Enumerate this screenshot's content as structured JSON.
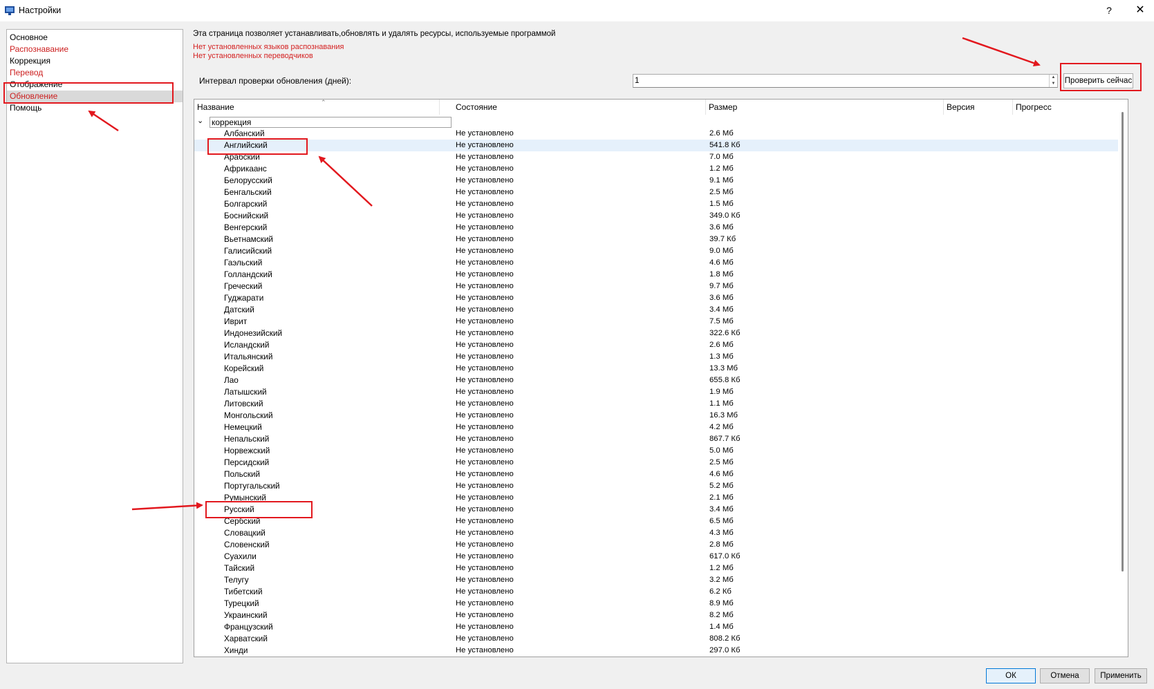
{
  "window": {
    "title": "Настройки",
    "help_label": "?",
    "close_label": "✕"
  },
  "sidebar": {
    "items": [
      {
        "label": "Основное",
        "color": "#000000"
      },
      {
        "label": "Распознавание",
        "color": "#cc1f1f"
      },
      {
        "label": "Коррекция",
        "color": "#000000"
      },
      {
        "label": "Перевод",
        "color": "#cc1f1f"
      },
      {
        "label": "Отображение",
        "color": "#000000"
      },
      {
        "label": "Обновление",
        "color": "#cc1f1f",
        "selected": true
      },
      {
        "label": "Помощь",
        "color": "#000000"
      }
    ]
  },
  "main": {
    "description": "Эта страница позволяет устанавливать,обновлять и удалять ресурсы, используемые программой",
    "warnings": [
      "Нет установленных языков распознавания",
      "Нет установленных переводчиков"
    ],
    "interval_label": "Интервал проверки обновления (дней):",
    "interval_value": "1",
    "check_button": "Проверить сейчас"
  },
  "table": {
    "columns": [
      "Название",
      "Состояние",
      "Размер",
      "Версия",
      "Прогресс"
    ],
    "group": "коррекция",
    "rows": [
      {
        "name": "Албанский",
        "state": "Не установлено",
        "size": "2.6 Мб"
      },
      {
        "name": "Английский",
        "state": "Не установлено",
        "size": "541.8 Кб"
      },
      {
        "name": "Арабский",
        "state": "Не установлено",
        "size": "7.0 Мб"
      },
      {
        "name": "Африкаанс",
        "state": "Не установлено",
        "size": "1.2 Мб"
      },
      {
        "name": "Белорусский",
        "state": "Не установлено",
        "size": "9.1 Мб"
      },
      {
        "name": "Бенгальский",
        "state": "Не установлено",
        "size": "2.5 Мб"
      },
      {
        "name": "Болгарский",
        "state": "Не установлено",
        "size": "1.5 Мб"
      },
      {
        "name": "Боснийский",
        "state": "Не установлено",
        "size": "349.0 Кб"
      },
      {
        "name": "Венгерский",
        "state": "Не установлено",
        "size": "3.6 Мб"
      },
      {
        "name": "Вьетнамский",
        "state": "Не установлено",
        "size": "39.7 Кб"
      },
      {
        "name": "Галисийский",
        "state": "Не установлено",
        "size": "9.0 Мб"
      },
      {
        "name": "Гаэльский",
        "state": "Не установлено",
        "size": "4.6 Мб"
      },
      {
        "name": "Голландский",
        "state": "Не установлено",
        "size": "1.8 Мб"
      },
      {
        "name": "Греческий",
        "state": "Не установлено",
        "size": "9.7 Мб"
      },
      {
        "name": "Гуджарати",
        "state": "Не установлено",
        "size": "3.6 Мб"
      },
      {
        "name": "Датский",
        "state": "Не установлено",
        "size": "3.4 Мб"
      },
      {
        "name": "Иврит",
        "state": "Не установлено",
        "size": "7.5 Мб"
      },
      {
        "name": "Индонезийский",
        "state": "Не установлено",
        "size": "322.6 Кб"
      },
      {
        "name": "Исландский",
        "state": "Не установлено",
        "size": "2.6 Мб"
      },
      {
        "name": "Итальянский",
        "state": "Не установлено",
        "size": "1.3 Мб"
      },
      {
        "name": "Корейский",
        "state": "Не установлено",
        "size": "13.3 Мб"
      },
      {
        "name": "Лао",
        "state": "Не установлено",
        "size": "655.8 Кб"
      },
      {
        "name": "Латышский",
        "state": "Не установлено",
        "size": "1.9 Мб"
      },
      {
        "name": "Литовский",
        "state": "Не установлено",
        "size": "1.1 Мб"
      },
      {
        "name": "Монгольский",
        "state": "Не установлено",
        "size": "16.3 Мб"
      },
      {
        "name": "Немецкий",
        "state": "Не установлено",
        "size": "4.2 Мб"
      },
      {
        "name": "Непальский",
        "state": "Не установлено",
        "size": "867.7 Кб"
      },
      {
        "name": "Норвежский",
        "state": "Не установлено",
        "size": "5.0 Мб"
      },
      {
        "name": "Персидский",
        "state": "Не установлено",
        "size": "2.5 Мб"
      },
      {
        "name": "Польский",
        "state": "Не установлено",
        "size": "4.6 Мб"
      },
      {
        "name": "Португальский",
        "state": "Не установлено",
        "size": "5.2 Мб"
      },
      {
        "name": "Румынский",
        "state": "Не установлено",
        "size": "2.1 Мб"
      },
      {
        "name": "Русский",
        "state": "Не установлено",
        "size": "3.4 Мб"
      },
      {
        "name": "Сербский",
        "state": "Не установлено",
        "size": "6.5 Мб"
      },
      {
        "name": "Словацкий",
        "state": "Не установлено",
        "size": "4.3 Мб"
      },
      {
        "name": "Словенский",
        "state": "Не установлено",
        "size": "2.8 Мб"
      },
      {
        "name": "Суахили",
        "state": "Не установлено",
        "size": "617.0 Кб"
      },
      {
        "name": "Тайский",
        "state": "Не установлено",
        "size": "1.2 Мб"
      },
      {
        "name": "Телугу",
        "state": "Не установлено",
        "size": "3.2 Мб"
      },
      {
        "name": "Тибетский",
        "state": "Не установлено",
        "size": "6.2 Кб"
      },
      {
        "name": "Турецкий",
        "state": "Не установлено",
        "size": "8.9 Мб"
      },
      {
        "name": "Украинский",
        "state": "Не установлено",
        "size": "8.2 Мб"
      },
      {
        "name": "Французский",
        "state": "Не установлено",
        "size": "1.4 Мб"
      },
      {
        "name": "Харватский",
        "state": "Не установлено",
        "size": "808.2 Кб"
      },
      {
        "name": "Хинди",
        "state": "Не установлено",
        "size": "297.0 Кб"
      }
    ]
  },
  "footer": {
    "ok": "ОК",
    "cancel": "Отмена",
    "apply": "Применить"
  },
  "colors": {
    "annotation": "#e2181e",
    "warning_text": "#d42020",
    "selection": "#d9d9d9",
    "row_highlight": "#e5f0fb"
  },
  "icons": {
    "app": "app-window-icon",
    "expand": "chevron-down-icon",
    "sort": "sort-up-icon"
  }
}
